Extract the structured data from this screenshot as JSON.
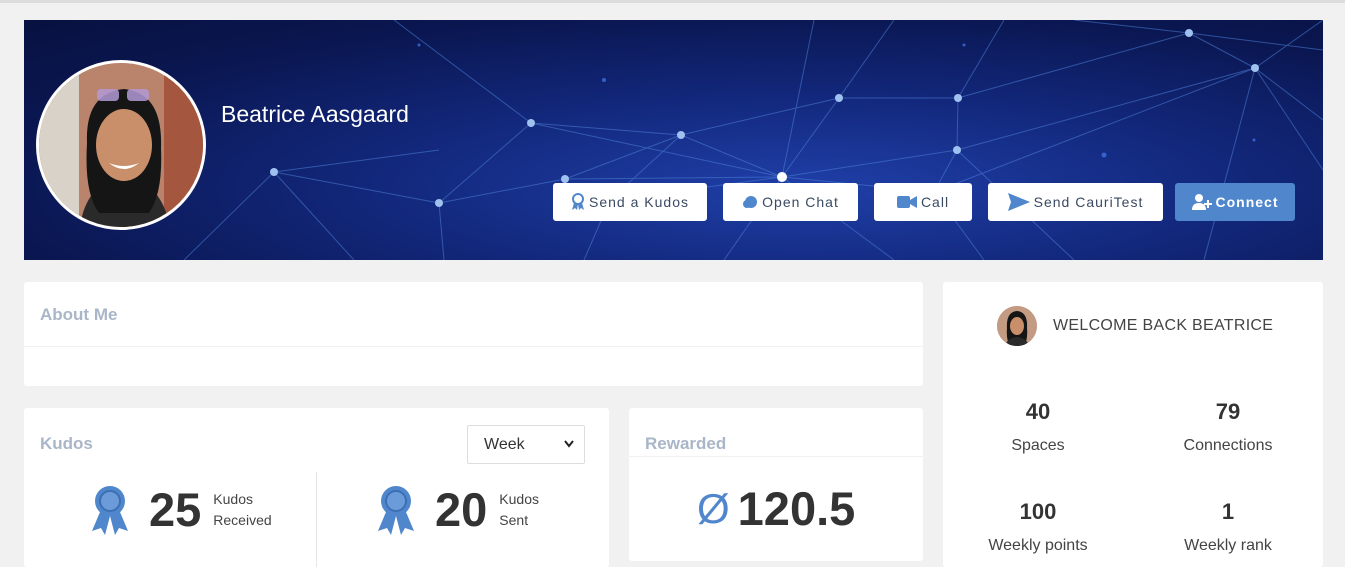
{
  "profile": {
    "name": "Beatrice Aasgaard"
  },
  "actions": {
    "send_kudos": "Send a Kudos",
    "open_chat": "Open Chat",
    "call": "Call",
    "send_test": "Send CauriTest",
    "connect": "Connect"
  },
  "about": {
    "title": "About Me"
  },
  "kudos": {
    "title": "Kudos",
    "period": "Week",
    "received": {
      "value": "25",
      "label1": "Kudos",
      "label2": "Received"
    },
    "sent": {
      "value": "20",
      "label1": "Kudos",
      "label2": "Sent"
    }
  },
  "rewarded": {
    "title": "Rewarded",
    "symbol": "Ø",
    "value": "120.5"
  },
  "welcome": {
    "text": "WELCOME BACK BEATRICE",
    "stats": [
      {
        "value": "40",
        "label": "Spaces"
      },
      {
        "value": "79",
        "label": "Connections"
      },
      {
        "value": "100",
        "label": "Weekly points"
      },
      {
        "value": "1",
        "label": "Weekly rank"
      }
    ]
  },
  "colors": {
    "accent": "#4f86cc",
    "title": "#a9b6c8",
    "banner": "#12277a"
  },
  "icons": [
    "award-icon",
    "chat-icon",
    "video-icon",
    "send-icon",
    "user-plus-icon",
    "chevron-down-icon"
  ]
}
